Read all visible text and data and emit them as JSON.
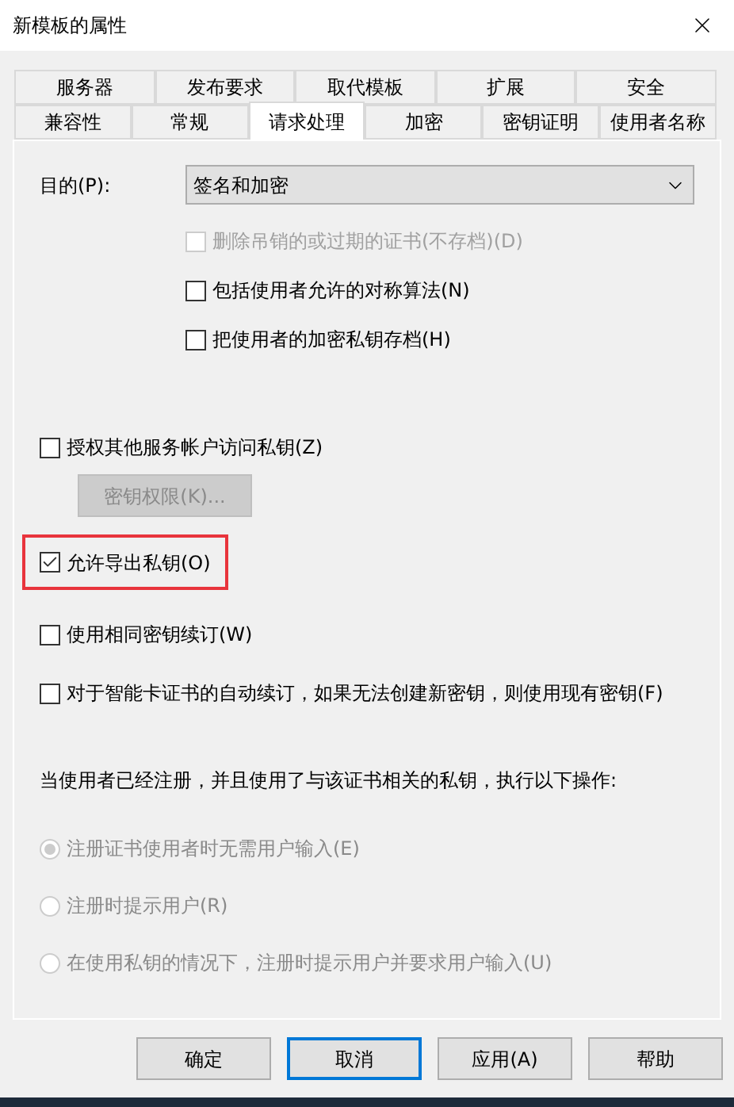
{
  "window": {
    "title": "新模板的属性"
  },
  "tab_rows": [
    [
      {
        "label": "服务器",
        "selected": false
      },
      {
        "label": "发布要求",
        "selected": false
      },
      {
        "label": "取代模板",
        "selected": false
      },
      {
        "label": "扩展",
        "selected": false
      },
      {
        "label": "安全",
        "selected": false
      }
    ],
    [
      {
        "label": "兼容性",
        "selected": false
      },
      {
        "label": "常规",
        "selected": false
      },
      {
        "label": "请求处理",
        "selected": true
      },
      {
        "label": "加密",
        "selected": false
      },
      {
        "label": "密钥证明",
        "selected": false
      },
      {
        "label": "使用者名称",
        "selected": false
      }
    ]
  ],
  "purpose": {
    "label": "目的(P):",
    "value": "签名和加密"
  },
  "purpose_options": [
    {
      "label": "删除吊销的或过期的证书(不存档)(D)",
      "checked": false,
      "disabled": true
    },
    {
      "label": "包括使用者允许的对称算法(N)",
      "checked": false,
      "disabled": false
    },
    {
      "label": "把使用者的加密私钥存档(H)",
      "checked": false,
      "disabled": false
    }
  ],
  "options": [
    {
      "kind": "checkbox",
      "label": "授权其他服务帐户访问私钥(Z)",
      "checked": false,
      "highlighted": false
    },
    {
      "kind": "button",
      "label": "密钥权限(K)...",
      "disabled": true
    },
    {
      "kind": "checkbox",
      "label": "允许导出私钥(O)",
      "checked": true,
      "highlighted": true
    },
    {
      "kind": "checkbox",
      "label": "使用相同密钥续订(W)",
      "checked": false,
      "highlighted": false
    },
    {
      "kind": "checkbox",
      "label": "对于智能卡证书的自动续订，如果无法创建新密钥，则使用现有密钥(F)",
      "checked": false,
      "highlighted": false
    }
  ],
  "enrollment": {
    "prompt": "当使用者已经注册，并且使用了与该证书相关的私钥，执行以下操作:",
    "choices": [
      {
        "label": "注册证书使用者时无需用户输入(E)",
        "selected": true,
        "disabled": true
      },
      {
        "label": "注册时提示用户(R)",
        "selected": false,
        "disabled": true
      },
      {
        "label": "在使用私钥的情况下，注册时提示用户并要求用户输入(U)",
        "selected": false,
        "disabled": true
      }
    ]
  },
  "buttons": [
    {
      "label": "确定",
      "default": false
    },
    {
      "label": "取消",
      "default": true
    },
    {
      "label": "应用(A)",
      "default": false
    },
    {
      "label": "帮助",
      "default": false
    }
  ]
}
